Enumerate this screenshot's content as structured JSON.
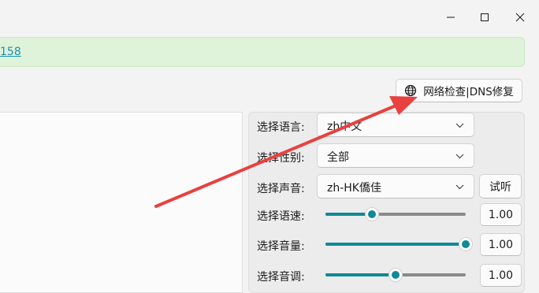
{
  "window": {
    "minimize_icon": "minimize-icon",
    "maximize_icon": "maximize-icon",
    "close_icon": "close-icon"
  },
  "notice": {
    "link_text": "158"
  },
  "dns_button": {
    "icon": "globe-icon",
    "label": "网络检查|DNS修复"
  },
  "form": {
    "language": {
      "label": "选择语言:",
      "value": "zh中文"
    },
    "gender": {
      "label": "选择性别:",
      "value": "全部"
    },
    "voice": {
      "label": "选择声音:",
      "value": "zh-HK僑佳",
      "preview_label": "试听"
    },
    "rate": {
      "label": "选择语速:",
      "value": "1.00",
      "level": 0.33
    },
    "volume": {
      "label": "选择音量:",
      "value": "1.00",
      "level": 1.0
    },
    "pitch": {
      "label": "选择音调:",
      "value": "1.00",
      "level": 0.5
    }
  },
  "colors": {
    "accent": "#0f8a96",
    "annotation_arrow": "#e8413f",
    "notice_bg": "#dff3da"
  }
}
